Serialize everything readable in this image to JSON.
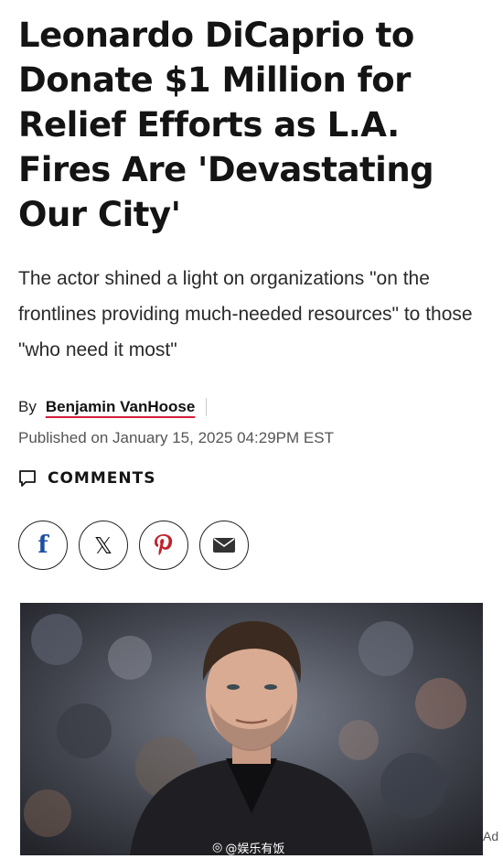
{
  "article": {
    "headline": "Leonardo DiCaprio to Donate $1 Million for Relief Efforts as L.A. Fires Are 'Devastating Our City'",
    "dek": "The actor shined a light on organizations \"on the frontlines providing much-needed resources\" to those \"who need it most\"",
    "by_label": "By",
    "author": "Benjamin VanHoose",
    "published": "Published on January 15, 2025 04:29PM EST",
    "comments_label": "COMMENTS"
  },
  "share": {
    "facebook_glyph": "f",
    "x_glyph": "𝕏",
    "icons": [
      "facebook-icon",
      "x-icon",
      "pinterest-icon",
      "email-icon"
    ]
  },
  "media": {
    "watermark": "@娱乐有饭",
    "ad_label": "Ad"
  },
  "colors": {
    "accent_underline": "#d21f3c",
    "facebook": "#1d4fa1",
    "pinterest": "#c2212b"
  }
}
